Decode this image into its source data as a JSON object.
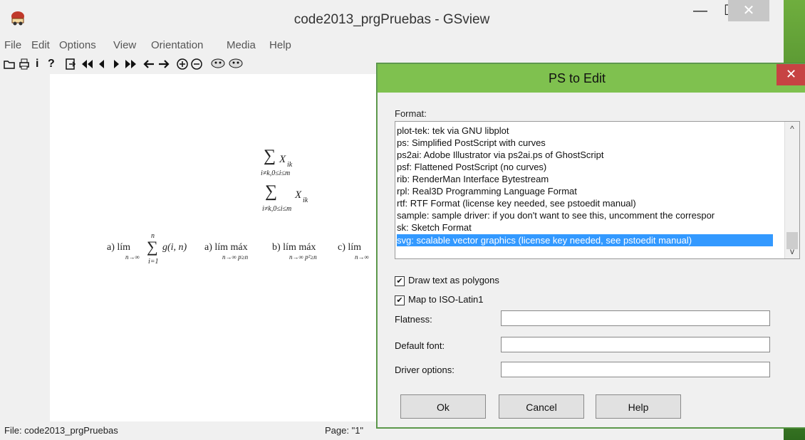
{
  "gsview": {
    "title": "code2013_prgPruebas - GSview",
    "menu": [
      "File",
      "Edit",
      "Options",
      "View",
      "Orientation",
      "Media",
      "Help"
    ],
    "toolbar": {
      "open_icon": "open-folder-icon",
      "print_icon": "printer-icon",
      "info_label": "i",
      "help_label": "?",
      "goto_icon": "goto-page-icon",
      "first_icon": "first-page-icon",
      "prev_icon": "prev-page-icon",
      "next_icon": "next-page-icon",
      "last_icon": "last-page-icon",
      "back_icon": "back-arrow-icon",
      "forward_icon": "forward-arrow-icon",
      "zoom_in_icon": "zoom-in-icon",
      "zoom_out_icon": "zoom-out-icon",
      "ghost_icon": "ghost-icon"
    },
    "window_buttons": {
      "minimize": "—",
      "maximize": "☐",
      "close": "✕"
    },
    "status": {
      "file": "File: code2013_prgPruebas",
      "page": "Page: \"1\""
    },
    "document": {
      "sum1_symbol": "∑",
      "sum1_var": "X",
      "sum1_sub": "ik",
      "sum1_index": "i≠k,0≤i≤m",
      "sum2_symbol": "∑",
      "sum2_var": "X",
      "sum2_sub": "ik",
      "sum2_index": "i≠k,0≤i≤m",
      "expr_a1": "a) lím",
      "expr_a1_sub": "n→∞",
      "expr_sum_top": "n",
      "expr_sum_sym": "∑",
      "expr_sum_bottom": "i=1",
      "expr_g": "g(i, n)",
      "expr_a2": "a) lím máx",
      "expr_a2_sub": "n→∞  p≥n",
      "expr_b": "b) lím máx",
      "expr_b_sub": "n→∞  p²≥n",
      "expr_c": "c) lím",
      "expr_c_sub": "n→∞"
    }
  },
  "dialog": {
    "title": "PS to Edit",
    "close": "✕",
    "format_label": "Format:",
    "formats": [
      "plot-tek:  tek  via GNU libplot",
      "ps:  Simplified PostScript with curves",
      "ps2ai:  Adobe Illustrator via ps2ai.ps of GhostScript",
      "psf:  Flattened PostScript (no curves)",
      "rib:  RenderMan Interface Bytestream",
      "rpl:  Real3D Programming Language Format",
      "rtf:  RTF Format (license key needed, see pstoedit manual)",
      "sample:  sample driver: if you don't want to see this, uncomment the correspor",
      "sk:  Sketch Format",
      "svg:  scalable vector graphics (license key needed, see pstoedit manual)"
    ],
    "selected_format": 9,
    "scroll_up": "^",
    "scroll_down": "v",
    "draw_text_polygons": {
      "label": "Draw text as polygons",
      "checked": true
    },
    "map_iso": {
      "label": "Map to ISO-Latin1",
      "checked": true
    },
    "flatness": {
      "label": "Flatness:",
      "value": ""
    },
    "default_font": {
      "label": "Default font:",
      "value": ""
    },
    "driver_options": {
      "label": "Driver options:",
      "value": ""
    },
    "buttons": {
      "ok": "Ok",
      "cancel": "Cancel",
      "help": "Help"
    }
  }
}
